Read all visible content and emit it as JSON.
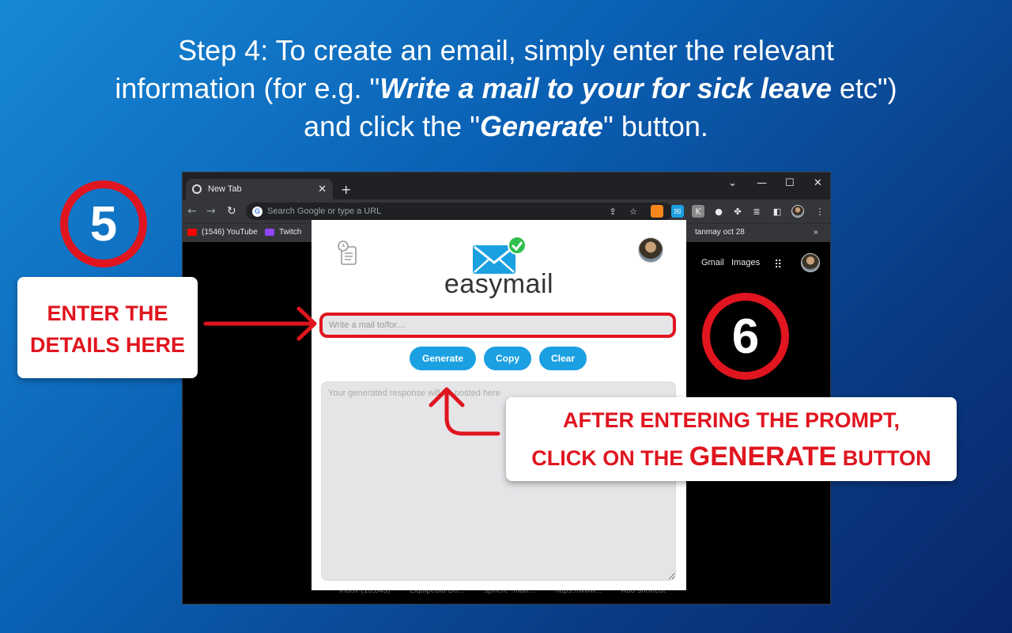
{
  "heading": {
    "line1": "Step 4: To create an email, simply enter the relevant",
    "line2_pre": "information (for e.g. \"",
    "line2_emph": "Write a mail to your for sick leave",
    "line2_post": " etc\")",
    "line3_pre": "and click the \"",
    "line3_emph": "Generate",
    "line3_post": "\" button."
  },
  "browser": {
    "tab_title": "New Tab",
    "tab_close": "✕",
    "new_tab": "+",
    "omnibox_placeholder": "Search Google or type a URL",
    "bookmarks": [
      "(1546) YouTube",
      "Twitch",
      "tanmay oct 28"
    ],
    "bookmarks_more": "»",
    "google_links": [
      "Gmail",
      "Images"
    ],
    "shortcuts": [
      "Inbox (13,843)",
      "Liquipedia Do...",
      "sphere -man...",
      "https://www...",
      "Add shortcut"
    ]
  },
  "popup": {
    "brand": "easymail",
    "input_placeholder": "Write a mail to/for....",
    "buttons": {
      "generate": "Generate",
      "copy": "Copy",
      "clear": "Clear"
    },
    "response_placeholder": "Your generated response will be posted here"
  },
  "callouts": {
    "step5_num": "5",
    "step5_line1": "ENTER THE",
    "step5_line2": "DETAILS HERE",
    "step6_num": "6",
    "step6_line1": "AFTER ENTERING THE PROMPT,",
    "step6_line2_pre": "CLICK ON THE ",
    "step6_line2_big": "GENERATE",
    "step6_line2_post": " BUTTON"
  },
  "colors": {
    "accent_red": "#e0151f",
    "button_blue": "#1ba0e2"
  }
}
